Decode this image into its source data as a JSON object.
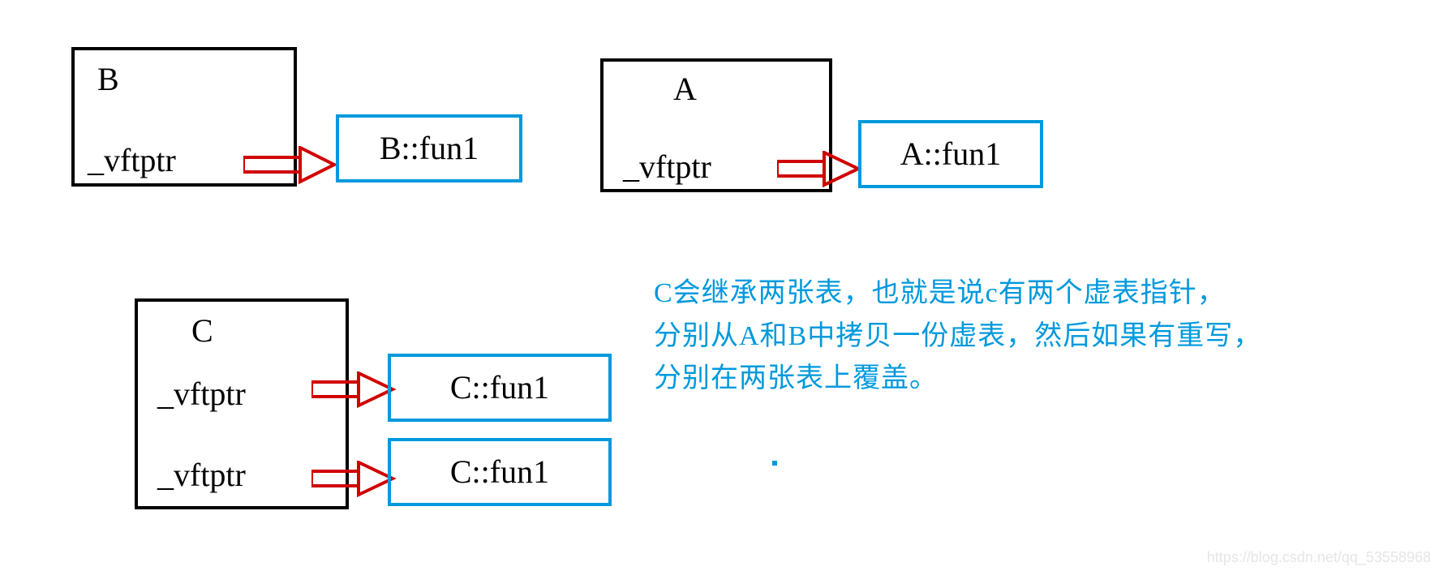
{
  "boxB": {
    "title": "B",
    "ptr": "_vftptr"
  },
  "vtblB": {
    "entry": "B::fun1"
  },
  "boxA": {
    "title": "A",
    "ptr": "_vftptr"
  },
  "vtblA": {
    "entry": "A::fun1"
  },
  "boxC": {
    "title": "C",
    "ptr1": "_vftptr",
    "ptr2": "_vftptr"
  },
  "vtblC1": {
    "entry": "C::fun1"
  },
  "vtblC2": {
    "entry": "C::fun1"
  },
  "explain": {
    "line1": "C会继承两张表，也就是说c有两个虚表指针，",
    "line2": "分别从A和B中拷贝一份虚表，然后如果有重写，",
    "line3": "分别在两张表上覆盖。"
  },
  "watermark": "https://blog.csdn.net/qq_53558968"
}
